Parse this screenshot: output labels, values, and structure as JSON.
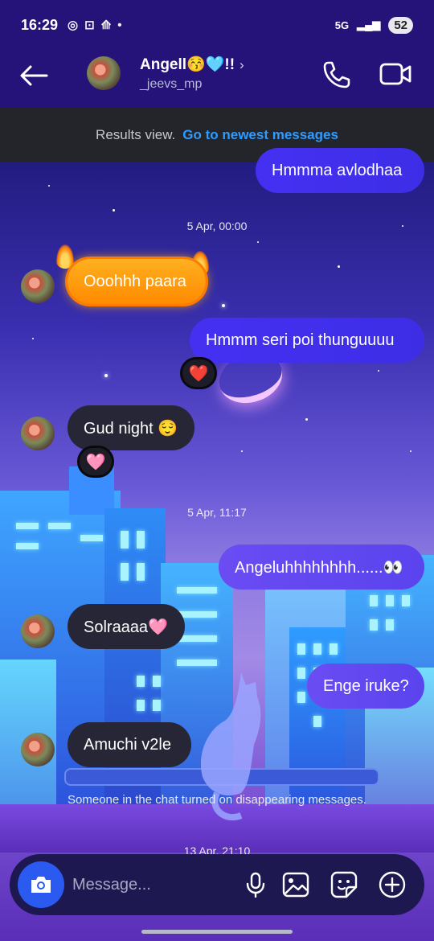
{
  "status_bar": {
    "time": "16:29",
    "icons": [
      "instagram-icon",
      "screenshot-icon",
      "myjio-icon",
      "dot-icon"
    ],
    "network": "5G",
    "battery": "52"
  },
  "header": {
    "contact_name": "Angell😚🩵!!",
    "chevron": "›",
    "username": "_jeevs_mp"
  },
  "results_banner": {
    "text": "Results view.",
    "link": "Go to newest messages"
  },
  "messages": [
    {
      "kind": "sent",
      "text": "Hmmma avlodhaa"
    },
    {
      "kind": "timestamp",
      "text": "5 Apr, 00:00"
    },
    {
      "kind": "received",
      "text": "Ooohhh paara",
      "effect": "fire"
    },
    {
      "kind": "sent",
      "text": "Hmmm seri poi thunguuuu",
      "reaction": "❤️"
    },
    {
      "kind": "received",
      "text": "Gud night 😌",
      "reaction": "🩷"
    },
    {
      "kind": "timestamp",
      "text": "5 Apr, 11:17"
    },
    {
      "kind": "sent",
      "text": "Angeluhhhhhhhh......👀"
    },
    {
      "kind": "received",
      "text": "Solraaaa🩷"
    },
    {
      "kind": "sent",
      "text": "Enge iruke?"
    },
    {
      "kind": "received",
      "text": "Amuchi v2le"
    }
  ],
  "system_message": "Someone in the chat turned on disappearing messages.",
  "next_timestamp": "13 Apr, 21:10",
  "composer": {
    "placeholder": "Message..."
  },
  "colors": {
    "header_bg": "#25137a",
    "sent_bubble": "#3d2ee6",
    "received_bubble": "#262636",
    "link": "#2f9bff",
    "camera_button": "#2a5af0"
  }
}
